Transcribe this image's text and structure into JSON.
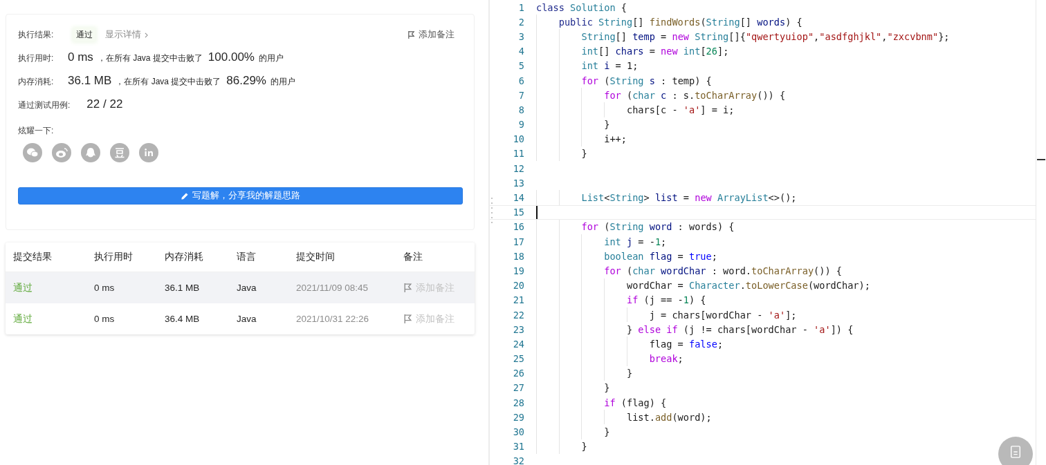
{
  "result_card": {
    "result_label": "执行结果:",
    "status": "通过",
    "details": "显示详情",
    "add_note": "添加备注",
    "stats": [
      {
        "label": "执行用时:",
        "value": "0 ms",
        "middle": "，在所有 Java 提交中击败了",
        "percent": "100.00%",
        "suffix": "的用户"
      },
      {
        "label": "内存消耗:",
        "value": "36.1 MB",
        "middle": "，在所有 Java 提交中击败了",
        "percent": "86.29%",
        "suffix": "的用户"
      }
    ],
    "tests_label": "通过测试用例:",
    "tests_value": "22 / 22",
    "share_label": "炫耀一下:",
    "solution_button": "写题解，分享我的解题思路"
  },
  "submissions": {
    "columns": [
      "提交结果",
      "执行用时",
      "内存消耗",
      "语言",
      "提交时间",
      "备注"
    ],
    "rows": [
      {
        "result": "通过",
        "time": "0 ms",
        "memory": "36.1 MB",
        "language": "Java",
        "submitted": "2021/11/09 08:45",
        "note": "添加备注",
        "highlighted": true
      },
      {
        "result": "通过",
        "time": "0 ms",
        "memory": "36.4 MB",
        "language": "Java",
        "submitted": "2021/10/31 22:26",
        "note": "添加备注",
        "highlighted": false
      }
    ]
  },
  "editor": {
    "lines": [
      {
        "number": "1",
        "current": false,
        "tokens": [
          {
            "kind": "storage",
            "text": "class"
          },
          {
            "kind": "type",
            "text": " Solution"
          },
          {
            "kind": "plain",
            "text": " {"
          }
        ]
      },
      {
        "number": "2",
        "current": false,
        "tokens": [
          {
            "kind": "storage",
            "text": "    public"
          },
          {
            "kind": "type",
            "text": " String"
          },
          {
            "kind": "plain",
            "text": "[] "
          },
          {
            "kind": "function",
            "text": "findWords"
          },
          {
            "kind": "plain",
            "text": "("
          },
          {
            "kind": "type",
            "text": "String"
          },
          {
            "kind": "plain",
            "text": "[] "
          },
          {
            "kind": "variable",
            "text": "words"
          },
          {
            "kind": "plain",
            "text": ") {"
          }
        ]
      },
      {
        "number": "3",
        "current": false,
        "tokens": [
          {
            "kind": "type",
            "text": "        String"
          },
          {
            "kind": "plain",
            "text": "[] "
          },
          {
            "kind": "variable",
            "text": "temp"
          },
          {
            "kind": "plain",
            "text": " = "
          },
          {
            "kind": "keyword",
            "text": "new"
          },
          {
            "kind": "type",
            "text": " String"
          },
          {
            "kind": "plain",
            "text": "[]{"
          },
          {
            "kind": "string",
            "text": "\"qwertyuiop\""
          },
          {
            "kind": "plain",
            "text": ","
          },
          {
            "kind": "string",
            "text": "\"asdfghjkl\""
          },
          {
            "kind": "plain",
            "text": ","
          },
          {
            "kind": "string",
            "text": "\"zxcvbnm\""
          },
          {
            "kind": "plain",
            "text": "};"
          }
        ]
      },
      {
        "number": "4",
        "current": false,
        "tokens": [
          {
            "kind": "type",
            "text": "        int"
          },
          {
            "kind": "plain",
            "text": "[] "
          },
          {
            "kind": "variable",
            "text": "chars"
          },
          {
            "kind": "plain",
            "text": " = "
          },
          {
            "kind": "keyword",
            "text": "new"
          },
          {
            "kind": "type",
            "text": " int"
          },
          {
            "kind": "plain",
            "text": "["
          },
          {
            "kind": "number",
            "text": "26"
          },
          {
            "kind": "plain",
            "text": "];"
          }
        ]
      },
      {
        "number": "5",
        "current": false,
        "tokens": [
          {
            "kind": "type",
            "text": "        int"
          },
          {
            "kind": "variable",
            "text": " i"
          },
          {
            "kind": "plain",
            "text": " = 1;"
          }
        ]
      },
      {
        "number": "6",
        "current": false,
        "tokens": [
          {
            "kind": "keyword",
            "text": "        for"
          },
          {
            "kind": "plain",
            "text": " ("
          },
          {
            "kind": "type",
            "text": "String"
          },
          {
            "kind": "variable",
            "text": " s"
          },
          {
            "kind": "plain",
            "text": " : temp) {"
          }
        ]
      },
      {
        "number": "7",
        "current": false,
        "tokens": [
          {
            "kind": "keyword",
            "text": "            for"
          },
          {
            "kind": "plain",
            "text": " ("
          },
          {
            "kind": "type",
            "text": "char"
          },
          {
            "kind": "variable",
            "text": " c"
          },
          {
            "kind": "plain",
            "text": " : s."
          },
          {
            "kind": "function",
            "text": "toCharArray"
          },
          {
            "kind": "plain",
            "text": "()) {"
          }
        ]
      },
      {
        "number": "8",
        "current": false,
        "tokens": [
          {
            "kind": "plain",
            "text": "                chars[c - "
          },
          {
            "kind": "string",
            "text": "'a'"
          },
          {
            "kind": "plain",
            "text": "] = i;"
          }
        ]
      },
      {
        "number": "9",
        "current": false,
        "tokens": [
          {
            "kind": "plain",
            "text": "            }"
          }
        ]
      },
      {
        "number": "10",
        "current": false,
        "tokens": [
          {
            "kind": "plain",
            "text": "            i++;"
          }
        ]
      },
      {
        "number": "11",
        "current": false,
        "tokens": [
          {
            "kind": "plain",
            "text": "        }"
          }
        ]
      },
      {
        "number": "12",
        "current": false
      },
      {
        "number": "13",
        "current": false
      },
      {
        "number": "14",
        "current": false,
        "tokens": [
          {
            "kind": "type",
            "text": "        List"
          },
          {
            "kind": "plain",
            "text": "<"
          },
          {
            "kind": "type",
            "text": "String"
          },
          {
            "kind": "plain",
            "text": "> "
          },
          {
            "kind": "variable",
            "text": "list"
          },
          {
            "kind": "plain",
            "text": " = "
          },
          {
            "kind": "keyword",
            "text": "new"
          },
          {
            "kind": "type",
            "text": " ArrayList"
          },
          {
            "kind": "plain",
            "text": "<>();"
          }
        ]
      },
      {
        "number": "15",
        "current": true
      },
      {
        "number": "16",
        "current": false,
        "tokens": [
          {
            "kind": "keyword",
            "text": "        for"
          },
          {
            "kind": "plain",
            "text": " ("
          },
          {
            "kind": "type",
            "text": "String"
          },
          {
            "kind": "variable",
            "text": " word"
          },
          {
            "kind": "plain",
            "text": " : words) {"
          }
        ]
      },
      {
        "number": "17",
        "current": false,
        "tokens": [
          {
            "kind": "type",
            "text": "            int"
          },
          {
            "kind": "variable",
            "text": " j"
          },
          {
            "kind": "plain",
            "text": " = -"
          },
          {
            "kind": "number",
            "text": "1"
          },
          {
            "kind": "plain",
            "text": ";"
          }
        ]
      },
      {
        "number": "18",
        "current": false,
        "tokens": [
          {
            "kind": "type",
            "text": "            boolean"
          },
          {
            "kind": "variable",
            "text": " flag"
          },
          {
            "kind": "plain",
            "text": " = "
          },
          {
            "kind": "constant",
            "text": "true"
          },
          {
            "kind": "plain",
            "text": ";"
          }
        ]
      },
      {
        "number": "19",
        "current": false,
        "tokens": [
          {
            "kind": "keyword",
            "text": "            for"
          },
          {
            "kind": "plain",
            "text": " ("
          },
          {
            "kind": "type",
            "text": "char"
          },
          {
            "kind": "variable",
            "text": " wordChar"
          },
          {
            "kind": "plain",
            "text": " : word."
          },
          {
            "kind": "function",
            "text": "toCharArray"
          },
          {
            "kind": "plain",
            "text": "()) {"
          }
        ]
      },
      {
        "number": "20",
        "current": false,
        "tokens": [
          {
            "kind": "plain",
            "text": "                wordChar = "
          },
          {
            "kind": "type",
            "text": "Character"
          },
          {
            "kind": "plain",
            "text": "."
          },
          {
            "kind": "function",
            "text": "toLowerCase"
          },
          {
            "kind": "plain",
            "text": "(wordChar);"
          }
        ]
      },
      {
        "number": "21",
        "current": false,
        "tokens": [
          {
            "kind": "keyword",
            "text": "                if"
          },
          {
            "kind": "plain",
            "text": " (j == -"
          },
          {
            "kind": "number",
            "text": "1"
          },
          {
            "kind": "plain",
            "text": ") {"
          }
        ]
      },
      {
        "number": "22",
        "current": false,
        "tokens": [
          {
            "kind": "plain",
            "text": "                    j = chars[wordChar - "
          },
          {
            "kind": "string",
            "text": "'a'"
          },
          {
            "kind": "plain",
            "text": "];"
          }
        ]
      },
      {
        "number": "23",
        "current": false,
        "tokens": [
          {
            "kind": "plain",
            "text": "                } "
          },
          {
            "kind": "keyword",
            "text": "else"
          },
          {
            "kind": "keyword",
            "text": " if"
          },
          {
            "kind": "plain",
            "text": " (j != chars[wordChar - "
          },
          {
            "kind": "string",
            "text": "'a'"
          },
          {
            "kind": "plain",
            "text": "]) {"
          }
        ]
      },
      {
        "number": "24",
        "current": false,
        "tokens": [
          {
            "kind": "plain",
            "text": "                    flag = "
          },
          {
            "kind": "constant",
            "text": "false"
          },
          {
            "kind": "plain",
            "text": ";"
          }
        ]
      },
      {
        "number": "25",
        "current": false,
        "tokens": [
          {
            "kind": "keyword",
            "text": "                    break"
          },
          {
            "kind": "plain",
            "text": ";"
          }
        ]
      },
      {
        "number": "26",
        "current": false,
        "tokens": [
          {
            "kind": "plain",
            "text": "                }"
          }
        ]
      },
      {
        "number": "27",
        "current": false,
        "tokens": [
          {
            "kind": "plain",
            "text": "            }"
          }
        ]
      },
      {
        "number": "28",
        "current": false,
        "tokens": [
          {
            "kind": "keyword",
            "text": "            if"
          },
          {
            "kind": "plain",
            "text": " (flag) {"
          }
        ]
      },
      {
        "number": "29",
        "current": false,
        "tokens": [
          {
            "kind": "plain",
            "text": "                list."
          },
          {
            "kind": "function",
            "text": "add"
          },
          {
            "kind": "plain",
            "text": "(word);"
          }
        ]
      },
      {
        "number": "30",
        "current": false,
        "tokens": [
          {
            "kind": "plain",
            "text": "            }"
          }
        ]
      },
      {
        "number": "31",
        "current": false,
        "tokens": [
          {
            "kind": "plain",
            "text": "        }"
          }
        ]
      },
      {
        "number": "32",
        "current": false
      }
    ]
  }
}
